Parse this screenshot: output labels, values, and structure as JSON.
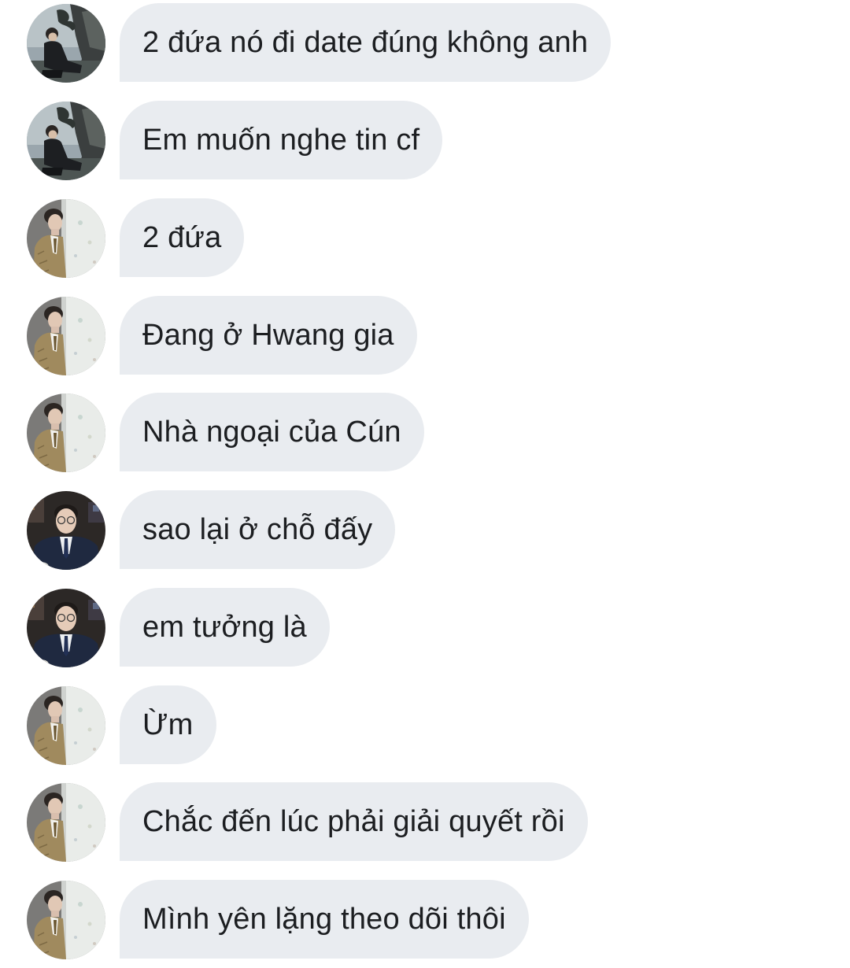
{
  "messages": [
    {
      "avatar": "avatar-a",
      "text": "2 đứa nó đi date đúng không anh"
    },
    {
      "avatar": "avatar-a",
      "text": "Em muốn nghe tin cf"
    },
    {
      "avatar": "avatar-b",
      "text": "2 đứa"
    },
    {
      "avatar": "avatar-b",
      "text": "Đang ở Hwang gia"
    },
    {
      "avatar": "avatar-b",
      "text": "Nhà ngoại của Cún"
    },
    {
      "avatar": "avatar-c",
      "text": "sao lại ở chỗ đấy"
    },
    {
      "avatar": "avatar-c",
      "text": "em tưởng là"
    },
    {
      "avatar": "avatar-b",
      "text": "Ừm"
    },
    {
      "avatar": "avatar-b",
      "text": "Chắc đến lúc phải giải quyết rồi"
    },
    {
      "avatar": "avatar-b",
      "text": "Mình yên lặng theo dõi thôi"
    }
  ],
  "colors": {
    "bubble_bg": "#e9ecf0",
    "text": "#1c1e21",
    "background": "#ffffff"
  }
}
